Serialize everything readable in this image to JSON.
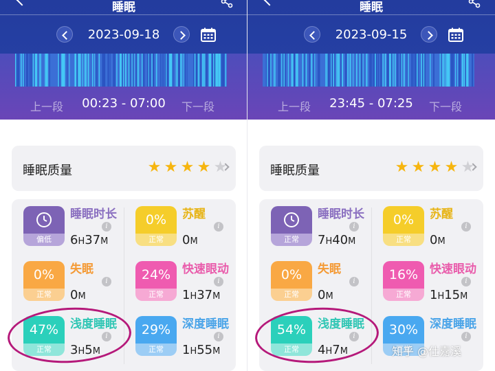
{
  "colors": {
    "header": "#2a3da0",
    "purple": "#7d63b5",
    "yellow": "#f5cd2a",
    "orange": "#f9a844",
    "pink": "#ef5bb0",
    "teal": "#2bd0bb",
    "blue": "#49a8f0",
    "star_on": "#f6b50f",
    "star_off": "#d0d0d4",
    "highlight": "#b5197a"
  },
  "panes": [
    {
      "title": "睡眠",
      "date": "2023-09-18",
      "segment_prev": "上一段",
      "segment_time": "00:23 - 07:00",
      "segment_next": "下一段",
      "quality_label": "睡眠质量",
      "stars": [
        "★",
        "★",
        "★",
        "★",
        "★"
      ],
      "rating": 4,
      "metrics": [
        {
          "name": "睡眠时长",
          "badge": "",
          "status": "偏低",
          "value_parts": [
            "6",
            "H",
            "37",
            "M"
          ],
          "icon": "clock-icon",
          "color": "purple",
          "name_color": "#8a6fc0"
        },
        {
          "name": "苏醒",
          "badge": "0%",
          "status": "正常",
          "value_parts": [
            "0",
            "M"
          ],
          "color": "yellow",
          "name_color": "#e7b416"
        },
        {
          "name": "失眠",
          "badge": "0%",
          "status": "正常",
          "value_parts": [
            "0",
            "M"
          ],
          "color": "orange",
          "name_color": "#f49a35"
        },
        {
          "name": "快速眼动",
          "badge": "24%",
          "status": "正常",
          "value_parts": [
            "1",
            "H",
            "37",
            "M"
          ],
          "color": "pink",
          "name_color": "#e95cab"
        },
        {
          "name": "浅度睡眠",
          "badge": "47%",
          "status": "正常",
          "value_parts": [
            "3",
            "H",
            "5",
            "M"
          ],
          "color": "teal",
          "name_color": "#2fc6b4"
        },
        {
          "name": "深度睡眠",
          "badge": "29%",
          "status": "正常",
          "value_parts": [
            "1",
            "H",
            "55",
            "M"
          ],
          "color": "blue",
          "name_color": "#4aa4e8"
        }
      ]
    },
    {
      "title": "睡眠",
      "date": "2023-09-15",
      "segment_prev": "上一段",
      "segment_time": "23:45 - 07:25",
      "segment_next": "下一段",
      "quality_label": "睡眠质量",
      "stars": [
        "★",
        "★",
        "★",
        "★",
        "★"
      ],
      "rating": 4,
      "metrics": [
        {
          "name": "睡眠时长",
          "badge": "",
          "status": "正常",
          "value_parts": [
            "7",
            "H",
            "40",
            "M"
          ],
          "icon": "clock-icon",
          "color": "purple",
          "name_color": "#8a6fc0"
        },
        {
          "name": "苏醒",
          "badge": "0%",
          "status": "正常",
          "value_parts": [
            "0",
            "M"
          ],
          "color": "yellow",
          "name_color": "#e7b416"
        },
        {
          "name": "失眠",
          "badge": "0%",
          "status": "正常",
          "value_parts": [
            "0",
            "M"
          ],
          "color": "orange",
          "name_color": "#f49a35"
        },
        {
          "name": "快速眼动",
          "badge": "16%",
          "status": "正常",
          "value_parts": [
            "1",
            "H",
            "15",
            "M"
          ],
          "color": "pink",
          "name_color": "#e95cab"
        },
        {
          "name": "浅度睡眠",
          "badge": "54%",
          "status": "正常",
          "value_parts": [
            "4",
            "H",
            "7",
            "M"
          ],
          "color": "teal",
          "name_color": "#2fc6b4"
        },
        {
          "name": "深度睡眠",
          "badge": "30%",
          "status": "正常",
          "value_parts": [
            "",
            "",
            "",
            ""
          ],
          "color": "blue",
          "name_color": "#4aa4e8"
        }
      ]
    }
  ],
  "watermark": "知乎 @仕嘉溪"
}
